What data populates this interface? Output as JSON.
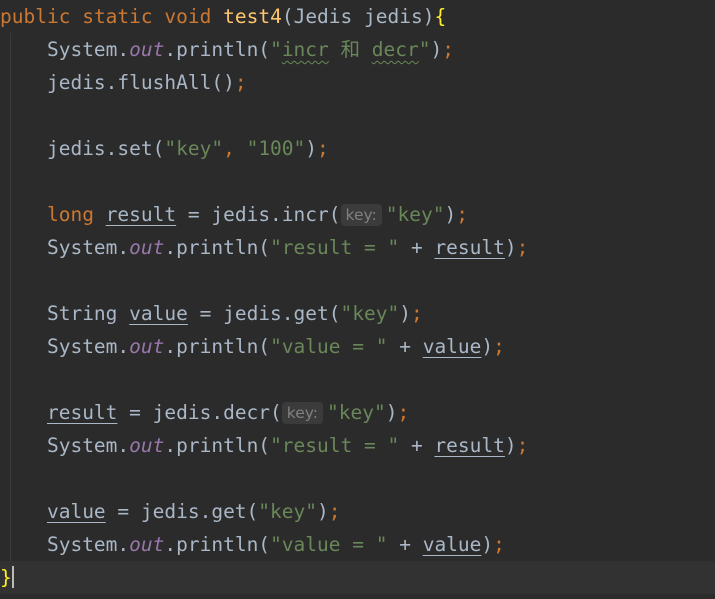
{
  "code": {
    "l1": {
      "kw_public": "public",
      "kw_static": "static",
      "kw_void": "void",
      "method": "test4",
      "open_paren": "(",
      "param_type": "Jedis",
      "param_name": "jedis",
      "close_paren": ")",
      "open_brace": "{"
    },
    "l2": {
      "obj": "System.",
      "field": "out",
      "call": ".println(",
      "str_open": "\"",
      "str_word1": "incr",
      "str_mid": " 和 ",
      "str_word2": "decr",
      "str_close": "\"",
      "close": ")",
      "semi": ";"
    },
    "l3": {
      "text": "jedis.flushAll()",
      "semi": ";"
    },
    "l5": {
      "call": "jedis.set(",
      "arg1": "\"key\"",
      "comma": ",",
      "arg2": "\"100\"",
      "close": ")",
      "semi": ";"
    },
    "l7": {
      "type": "long",
      "var": "result",
      "assign": " = jedis.incr(",
      "hint": "key:",
      "arg": "\"key\"",
      "close": ")",
      "semi": ";"
    },
    "l8": {
      "obj": "System.",
      "field": "out",
      "call": ".println(",
      "str": "\"result = \"",
      "plus": " + ",
      "var": "result",
      "close": ")",
      "semi": ";"
    },
    "l10": {
      "type": "String",
      "var": "value",
      "assign": " = jedis.get(",
      "arg": "\"key\"",
      "close": ")",
      "semi": ";"
    },
    "l11": {
      "obj": "System.",
      "field": "out",
      "call": ".println(",
      "str": "\"value = \"",
      "plus": " + ",
      "var": "value",
      "close": ")",
      "semi": ";"
    },
    "l13": {
      "var": "result",
      "assign": " = jedis.decr(",
      "hint": "key:",
      "arg": "\"key\"",
      "close": ")",
      "semi": ";"
    },
    "l14": {
      "obj": "System.",
      "field": "out",
      "call": ".println(",
      "str": "\"result = \"",
      "plus": " + ",
      "var": "result",
      "close": ")",
      "semi": ";"
    },
    "l16": {
      "var": "value",
      "assign": " = jedis.get(",
      "arg": "\"key\"",
      "close": ")",
      "semi": ";"
    },
    "l17": {
      "obj": "System.",
      "field": "out",
      "call": ".println(",
      "str": "\"value = \"",
      "plus": " + ",
      "var": "value",
      "close": ")",
      "semi": ";"
    },
    "l18": {
      "close_brace": "}"
    }
  }
}
